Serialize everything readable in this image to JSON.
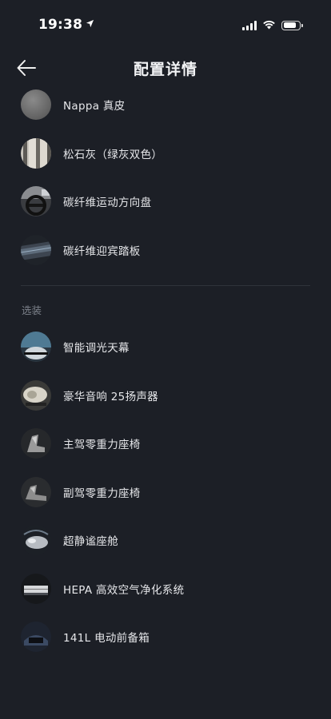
{
  "status_bar": {
    "time": "19:38",
    "battery_level": 0.85
  },
  "header": {
    "title": "配置详情",
    "back_icon": "arrow-left-icon"
  },
  "standard_items": [
    {
      "label": "Nappa 真皮",
      "thumb": "leather-swatch"
    },
    {
      "label": "松石灰（绿灰双色）",
      "thumb": "two-tone-swatch"
    },
    {
      "label": "碳纤维运动方向盘",
      "thumb": "steering-wheel"
    },
    {
      "label": "碳纤维迎宾踏板",
      "thumb": "door-sill"
    }
  ],
  "optional_section": {
    "title": "选装",
    "items": [
      {
        "label": "智能调光天幕",
        "thumb": "sunroof"
      },
      {
        "label": "豪华音响 25扬声器",
        "thumb": "speaker"
      },
      {
        "label": "主驾零重力座椅",
        "thumb": "driver-seat"
      },
      {
        "label": "副驾零重力座椅",
        "thumb": "passenger-seat"
      },
      {
        "label": "超静谧座舱",
        "thumb": "cabin"
      },
      {
        "label": "HEPA 高效空气净化系统",
        "thumb": "air-filter"
      },
      {
        "label": "141L 电动前备箱",
        "thumb": "front-trunk"
      }
    ]
  }
}
